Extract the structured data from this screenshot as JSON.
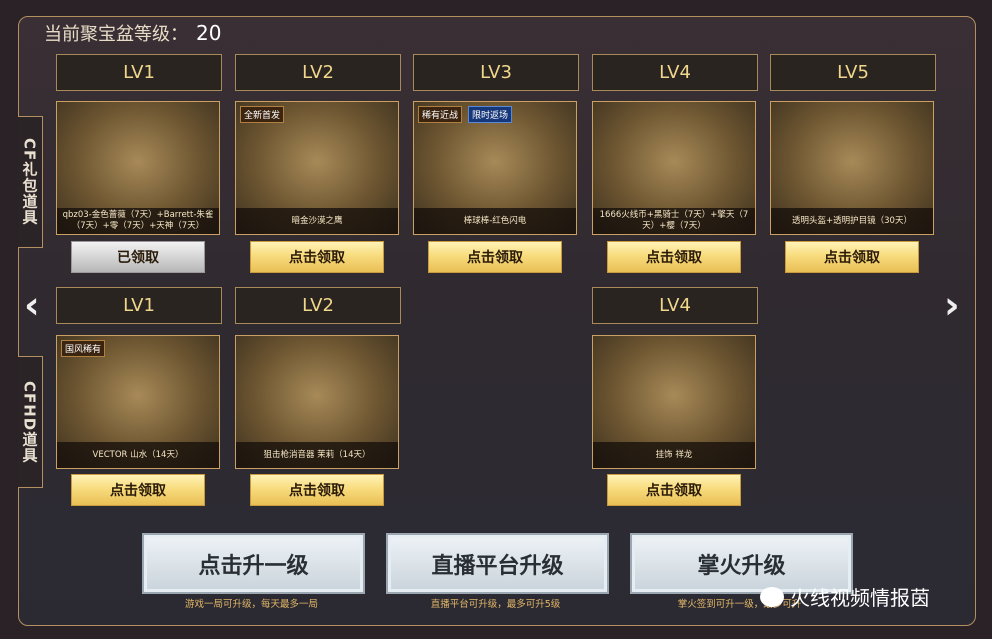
{
  "header": {
    "label": "当前聚宝盆等级：",
    "level": "20"
  },
  "tabs": {
    "cf": "CF礼包道具",
    "cfhd": "CFHD道具"
  },
  "nav": {
    "prev": "‹",
    "next": "›"
  },
  "row1": [
    {
      "lv": "LV1",
      "caption": "qbz03-金色蔷薇（7天）+Barrett-朱雀（7天）+零（7天）+天神（7天）",
      "badges": [],
      "claim": "已领取",
      "claimed": true
    },
    {
      "lv": "LV2",
      "caption": "暗金沙漠之鹰",
      "badges": [
        {
          "text": "全新首发",
          "style": "brown"
        }
      ],
      "claim": "点击领取",
      "claimed": false
    },
    {
      "lv": "LV3",
      "caption": "棒球棒-红色闪电",
      "badges": [
        {
          "text": "稀有近战",
          "style": "brown"
        },
        {
          "text": "限时返场",
          "style": "blue"
        }
      ],
      "claim": "点击领取",
      "claimed": false
    },
    {
      "lv": "LV4",
      "caption": "1666火线币+黑骑士（7天）+擎天（7天）+樱（7天）",
      "badges": [],
      "claim": "点击领取",
      "claimed": false
    },
    {
      "lv": "LV5",
      "caption": "透明头盔+透明护目镜（30天）",
      "badges": [],
      "claim": "点击领取",
      "claimed": false
    }
  ],
  "row2": [
    {
      "lv": "LV1",
      "caption": "VECTOR 山水（14天）",
      "badges": [
        {
          "text": "国风稀有",
          "style": "brown"
        }
      ],
      "claim": "点击领取"
    },
    {
      "lv": "LV2",
      "caption": "狙击枪消音器 茉莉（14天）",
      "badges": [],
      "claim": "点击领取"
    },
    {
      "lv": "LV4",
      "caption": "挂饰 祥龙",
      "badges": [],
      "claim": "点击领取"
    }
  ],
  "upgrade": [
    {
      "label": "点击升一级",
      "note": "游戏一局可升级，每天最多一局"
    },
    {
      "label": "直播平台升级",
      "note": "直播平台可升级，最多可升5级"
    },
    {
      "label": "掌火升级",
      "note": "掌火签到可升一级，最多可升"
    }
  ],
  "watermark": "火线视频情报茵"
}
